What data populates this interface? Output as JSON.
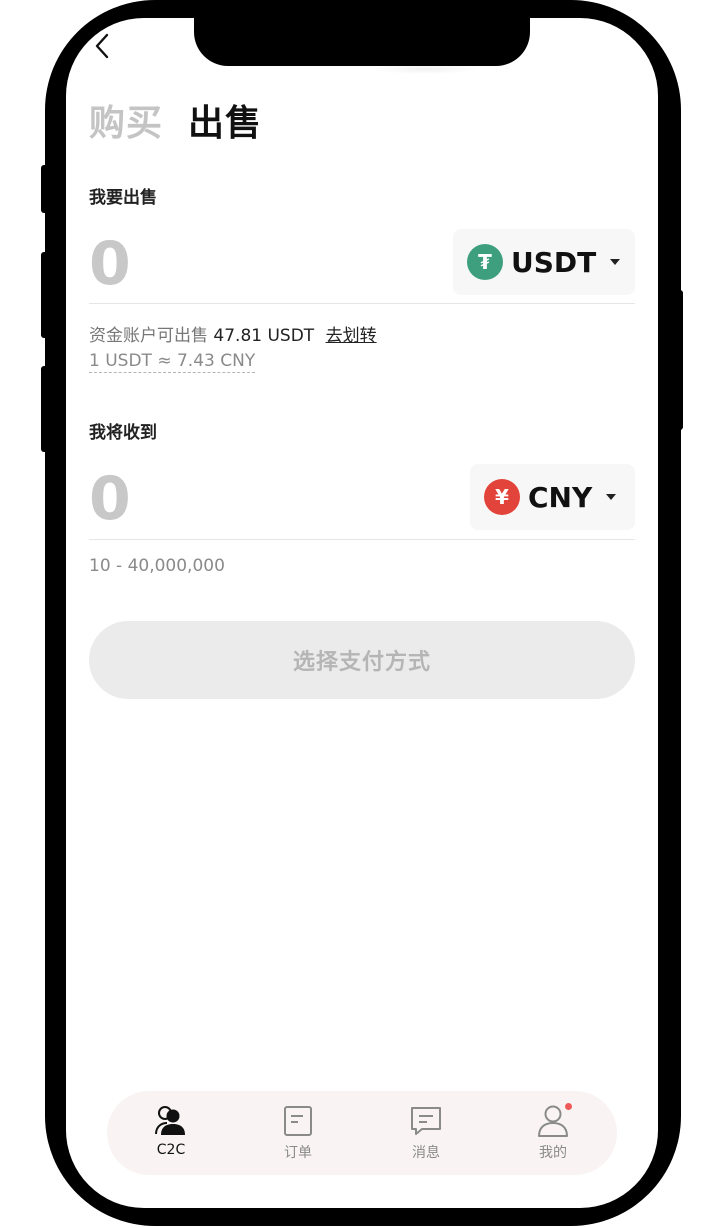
{
  "tabs": {
    "buy": "购买",
    "sell": "出售"
  },
  "sell_section": {
    "label": "我要出售",
    "amount": "0",
    "currency": "USDT",
    "currency_icon_glyph": "₮",
    "currency_color": "#3d9f7d"
  },
  "available": {
    "prefix": "资金账户可出售",
    "amount": "47.81 USDT",
    "transfer_link": "去划转"
  },
  "rate": "1 USDT ≈ 7.43 CNY",
  "receive_section": {
    "label": "我将收到",
    "amount": "0",
    "currency": "CNY",
    "currency_icon_glyph": "¥",
    "currency_color": "#e2433a"
  },
  "limit": "10 - 40,000,000",
  "pay_button": "选择支付方式",
  "tabbar": [
    {
      "label": "C2C",
      "icon": "users-icon",
      "active": true
    },
    {
      "label": "订单",
      "icon": "document-icon",
      "active": false
    },
    {
      "label": "消息",
      "icon": "message-icon",
      "active": false
    },
    {
      "label": "我的",
      "icon": "user-icon",
      "active": false,
      "badge": true
    }
  ],
  "colors": {
    "accent": "#111111",
    "inactive": "#8a8a8a",
    "badge": "#f0595a"
  }
}
